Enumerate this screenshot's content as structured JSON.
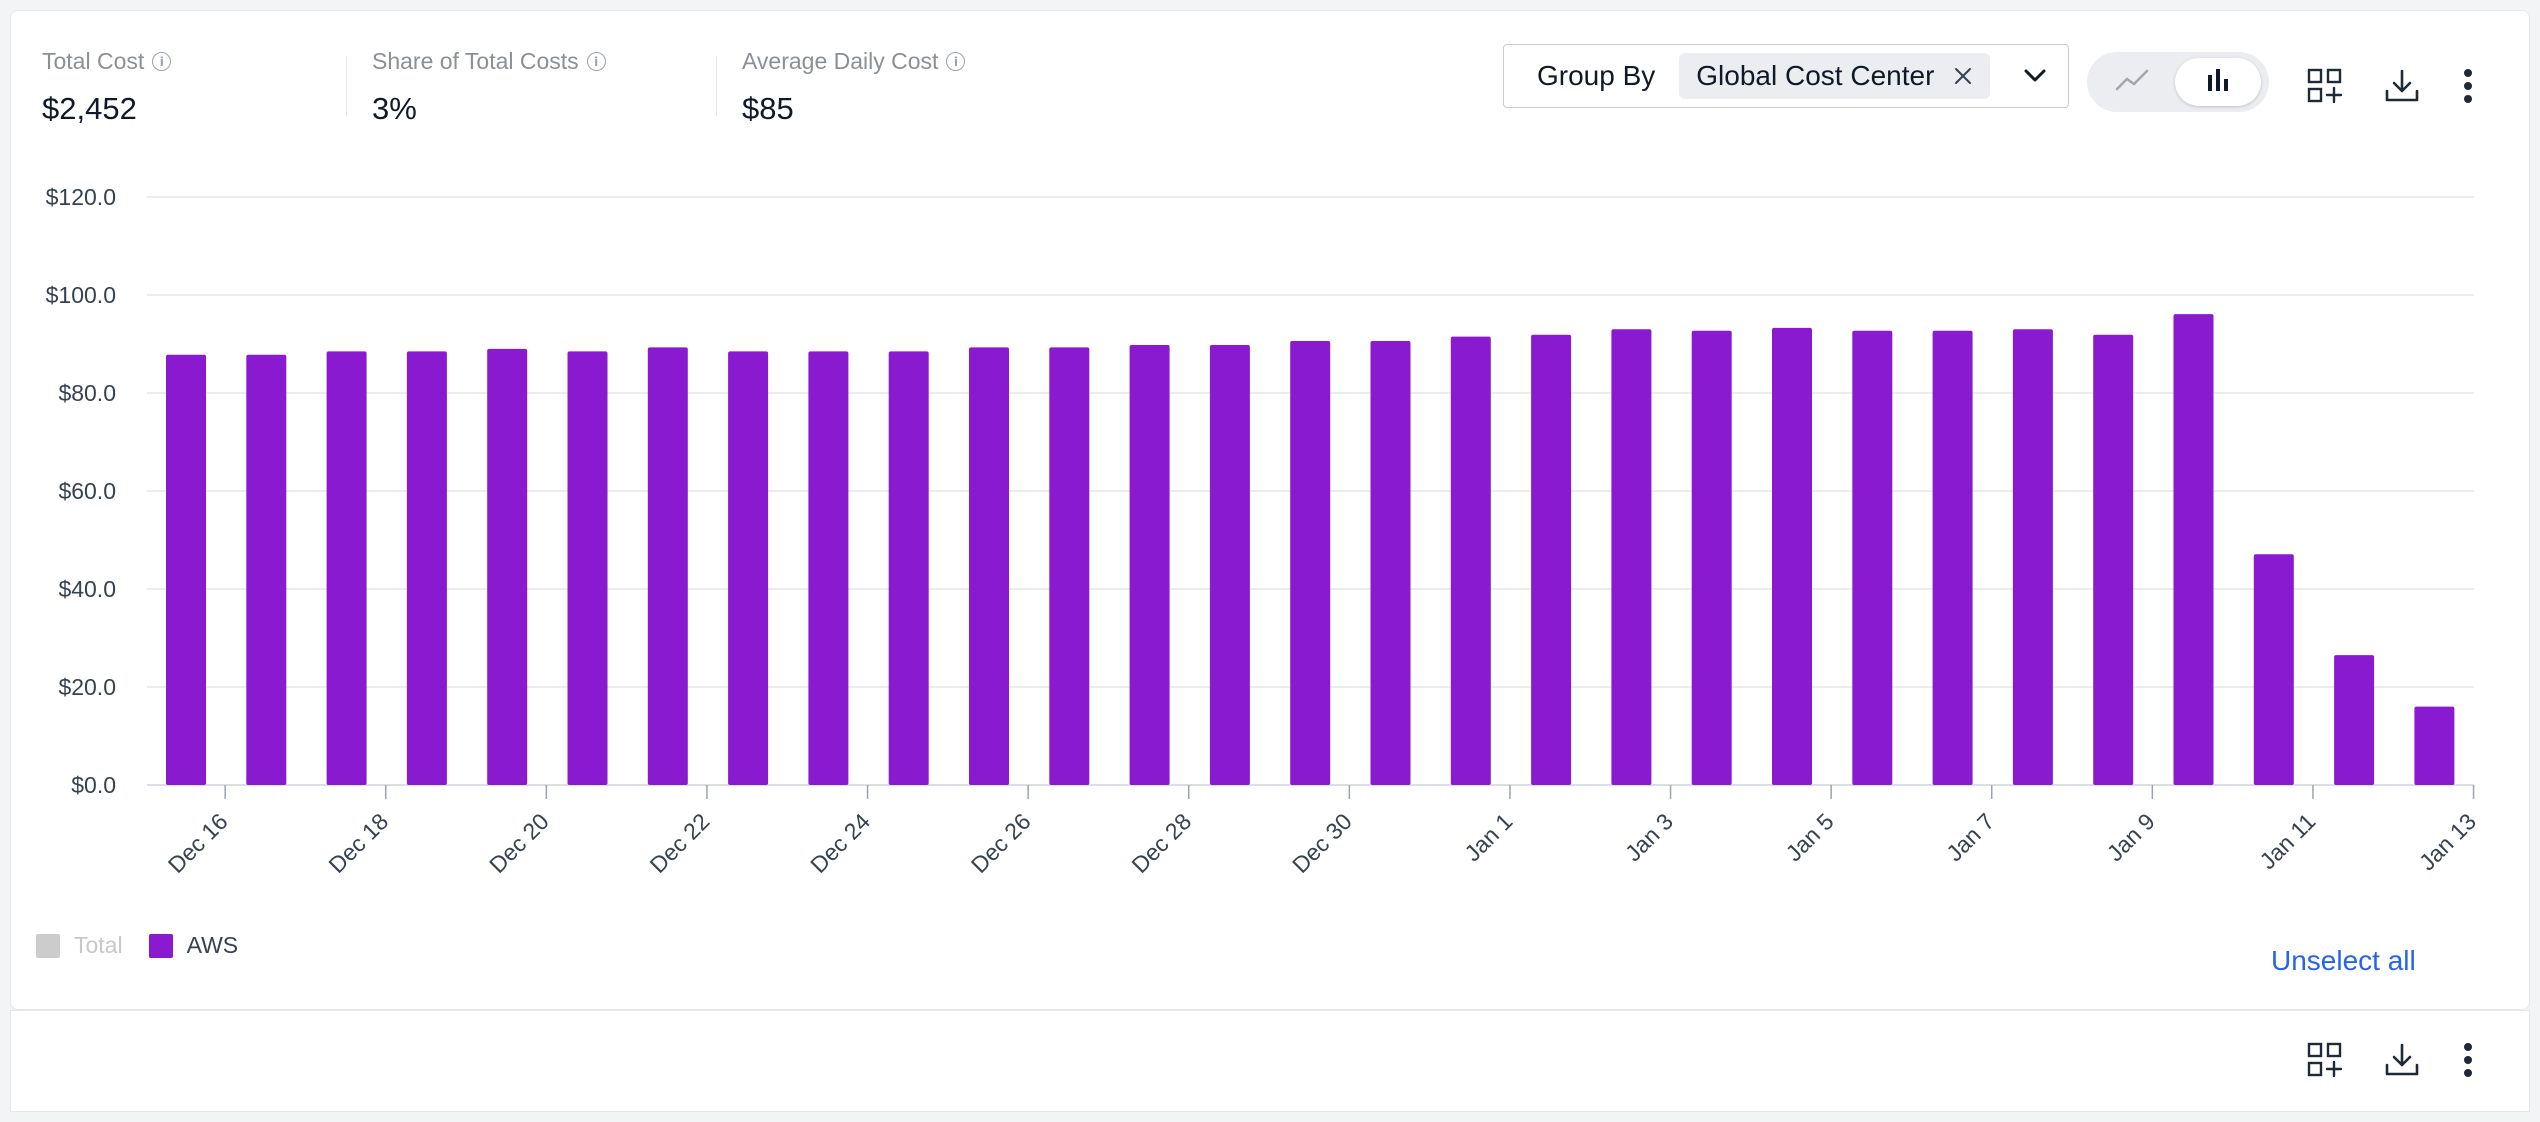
{
  "stats": [
    {
      "label": "Total Cost",
      "value": "$2,452"
    },
    {
      "label": "Share of Total Costs",
      "value": "3%"
    },
    {
      "label": "Average Daily Cost",
      "value": "$85"
    }
  ],
  "group_by": {
    "label": "Group By",
    "selected": "Global Cost Center"
  },
  "toolbar": {
    "line_icon": "line-chart-icon",
    "bar_icon": "bar-chart-icon",
    "add_widget_icon": "add-to-dashboard-icon",
    "download_icon": "download-icon",
    "more_icon": "more-vertical-icon"
  },
  "legend": [
    {
      "label": "Total",
      "color": "#cccccc",
      "active": false
    },
    {
      "label": "AWS",
      "color": "#8a1acf",
      "active": true
    }
  ],
  "unselect_all": "Unselect all",
  "colors": {
    "accent": "#8a1acf",
    "link": "#2563eb"
  },
  "chart_data": {
    "type": "bar",
    "ylim": [
      0,
      120
    ],
    "yticks": [
      "$0.0",
      "$20.0",
      "$40.0",
      "$60.0",
      "$80.0",
      "$100.0",
      "$120.0"
    ],
    "categories": [
      "Dec 15",
      "Dec 16",
      "Dec 17",
      "Dec 18",
      "Dec 19",
      "Dec 20",
      "Dec 21",
      "Dec 22",
      "Dec 23",
      "Dec 24",
      "Dec 25",
      "Dec 26",
      "Dec 27",
      "Dec 28",
      "Dec 29",
      "Dec 30",
      "Dec 31",
      "Jan 1",
      "Jan 2",
      "Jan 3",
      "Jan 4",
      "Jan 5",
      "Jan 6",
      "Jan 7",
      "Jan 8",
      "Jan 9",
      "Jan 10",
      "Jan 11",
      "Jan 12",
      "Jan 13"
    ],
    "tick_labels": [
      "Dec 16",
      "Dec 18",
      "Dec 20",
      "Dec 22",
      "Dec 24",
      "Dec 26",
      "Dec 28",
      "Dec 30",
      "Jan 1",
      "Jan 3",
      "Jan 5",
      "Jan 7",
      "Jan 9",
      "Jan 11",
      "Jan 13"
    ],
    "series": [
      {
        "name": "AWS",
        "color": "#8a1acf",
        "values": [
          87.8,
          87.8,
          88.5,
          88.5,
          89.0,
          88.5,
          89.3,
          88.5,
          88.5,
          88.5,
          89.3,
          89.3,
          89.8,
          89.8,
          90.6,
          90.6,
          91.5,
          91.9,
          93.0,
          92.7,
          93.3,
          92.7,
          92.7,
          93.0,
          91.9,
          96.1,
          47.1,
          26.5,
          16.0
        ]
      }
    ],
    "grid": true,
    "legend_position": "bottom-left"
  }
}
